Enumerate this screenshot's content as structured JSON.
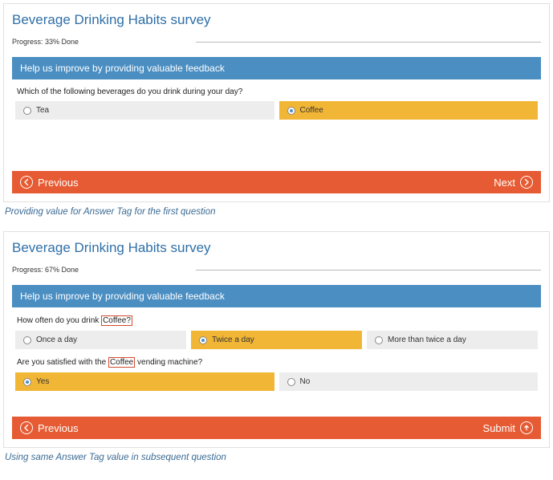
{
  "panel1": {
    "title": "Beverage Drinking Habits survey",
    "progress": "Progress: 33% Done",
    "section_header": "Help us improve by providing valuable feedback",
    "q1": {
      "text": "Which of the following beverages do you drink during your day?",
      "opt_tea": "Tea",
      "opt_coffee": "Coffee"
    },
    "prev": "Previous",
    "next": "Next"
  },
  "caption1": "Providing value for Answer Tag for the first question",
  "panel2": {
    "title": "Beverage Drinking Habits survey",
    "progress": "Progress: 67% Done",
    "section_header": "Help us improve by providing valuable feedback",
    "q1": {
      "prefix": "How often do you drink ",
      "tag": "Coffee?",
      "opt_once": "Once a day",
      "opt_twice": "Twice a day",
      "opt_more": "More than twice a day"
    },
    "q2": {
      "prefix": "Are you satisfied with the ",
      "tag": "Coffee",
      "suffix": " vending machine?",
      "opt_yes": "Yes",
      "opt_no": "No"
    },
    "prev": "Previous",
    "submit": "Submit"
  },
  "caption2": "Using same Answer Tag value in subsequent question"
}
